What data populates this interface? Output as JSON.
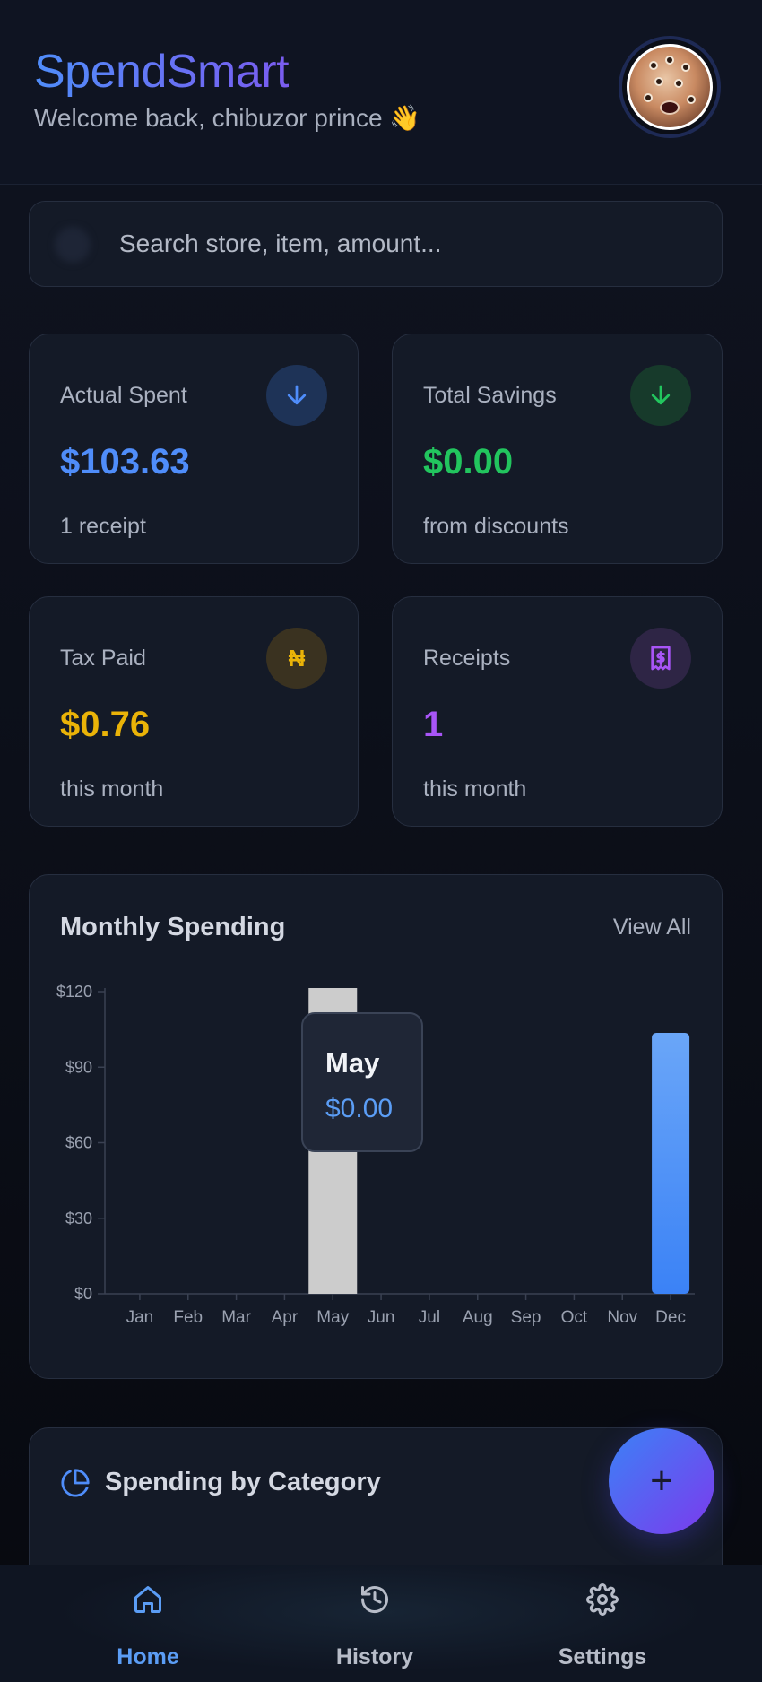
{
  "header": {
    "app_title": "SpendSmart",
    "welcome": "Welcome back, chibuzor prince 👋",
    "avatar_alt": "avatar"
  },
  "search": {
    "placeholder": "Search store, item, amount..."
  },
  "stats": [
    {
      "label": "Actual Spent",
      "value": "$103.63",
      "sub": "1 receipt",
      "icon": "arrow-down-icon",
      "color": "#4f8dfa",
      "icon_bg": "#1e3357"
    },
    {
      "label": "Total Savings",
      "value": "$0.00",
      "sub": "from discounts",
      "icon": "arrow-down-icon",
      "color": "#22c55e",
      "icon_bg": "#173a2b"
    },
    {
      "label": "Tax Paid",
      "value": "$0.76",
      "sub": "this month",
      "icon": "naira-icon",
      "color": "#eab308",
      "icon_bg": "#3a3220"
    },
    {
      "label": "Receipts",
      "value": "1",
      "sub": "this month",
      "icon": "receipt-icon",
      "color": "#a855f7",
      "icon_bg": "#2e2545"
    }
  ],
  "monthly_spending": {
    "title": "Monthly Spending",
    "view_all": "View All",
    "tooltip": {
      "month": "May",
      "value": "$0.00"
    }
  },
  "chart_data": {
    "type": "bar",
    "categories": [
      "Jan",
      "Feb",
      "Mar",
      "Apr",
      "May",
      "Jun",
      "Jul",
      "Aug",
      "Sep",
      "Oct",
      "Nov",
      "Dec"
    ],
    "values": [
      0,
      0,
      0,
      0,
      0,
      0,
      0,
      0,
      0,
      0,
      0,
      103.63
    ],
    "yticks": [
      "$0",
      "$30",
      "$60",
      "$90",
      "$120"
    ],
    "ylim": [
      0,
      120
    ],
    "highlighted_category": "May",
    "bar_color": "#4f8dfa",
    "highlight_color": "#cccccc"
  },
  "category": {
    "title": "Spending by Category"
  },
  "fab": {
    "label": "+"
  },
  "nav": {
    "items": [
      {
        "label": "Home",
        "active": true
      },
      {
        "label": "History",
        "active": false
      },
      {
        "label": "Settings",
        "active": false
      }
    ],
    "active_color": "#5b9df5",
    "inactive_color": "#b7bcc8"
  }
}
